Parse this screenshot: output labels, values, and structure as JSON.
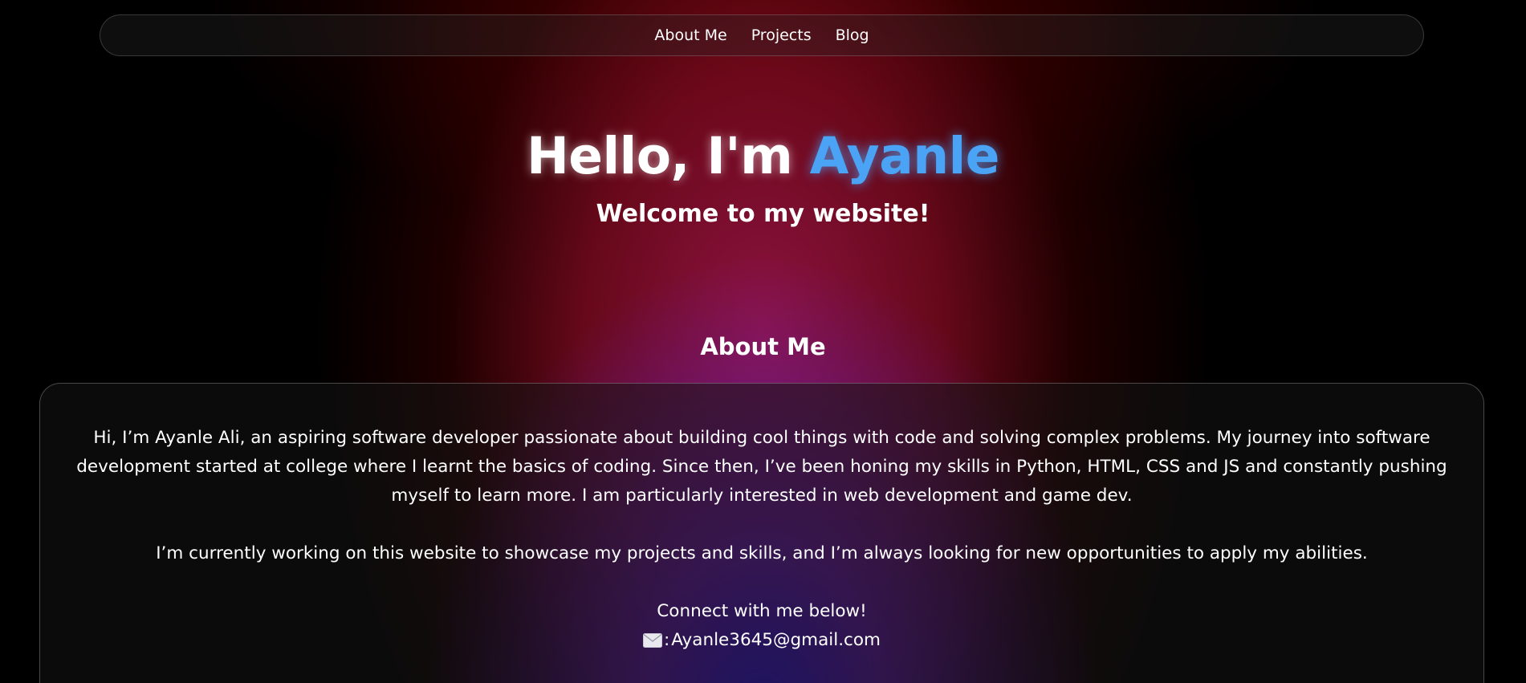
{
  "nav": {
    "items": [
      {
        "label": "About Me"
      },
      {
        "label": "Projects"
      },
      {
        "label": "Blog"
      }
    ]
  },
  "hero": {
    "greeting": "Hello, I'm ",
    "name": "Ayanle",
    "subtitle": "Welcome to my website!"
  },
  "about": {
    "heading": "About Me",
    "paragraph1": "Hi, I’m Ayanle Ali, an aspiring software developer passionate about building cool things with code and solving complex problems. My journey into software development started at college where I learnt the basics of coding. Since then, I’ve been honing my skills in Python, HTML, CSS and JS and constantly pushing myself to learn more. I am particularly interested in web development and game dev.",
    "paragraph2": "I’m currently working on this website to showcase my projects and skills, and I’m always looking for new opportunities to apply my abilities.",
    "connect": "Connect with me below!",
    "email_separator": ": ",
    "email": "Ayanle3645@gmail.com",
    "email_icon": "mail-icon"
  },
  "colors": {
    "accent": "#4aa3f5",
    "text": "#ffffff",
    "background": "#000000"
  }
}
